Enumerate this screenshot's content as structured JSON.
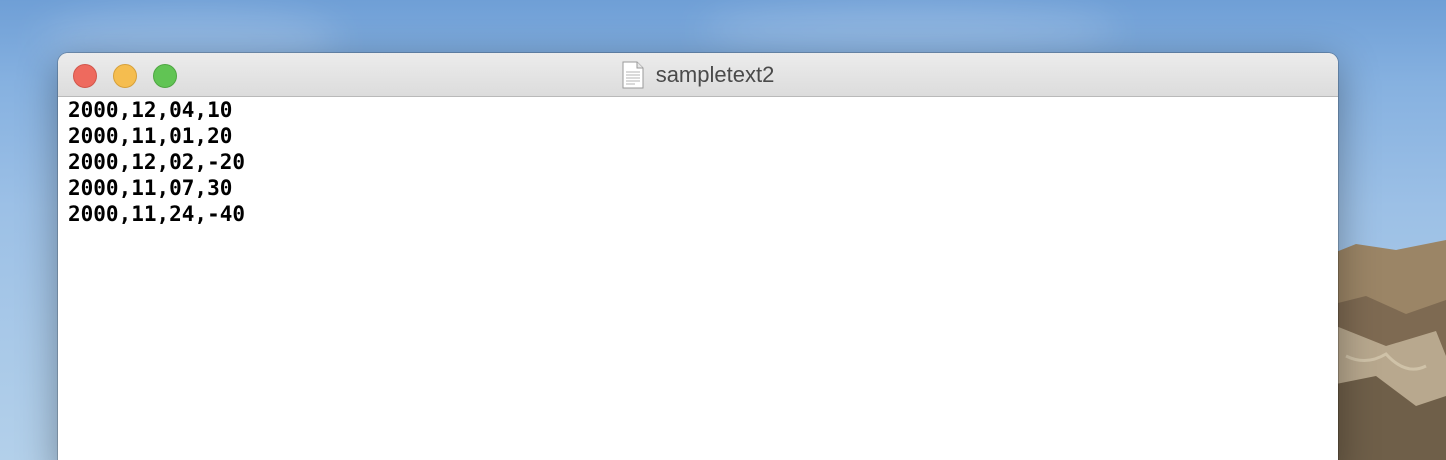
{
  "window": {
    "title": "sampletext2",
    "title_icon": "plain-text-document-icon"
  },
  "traffic_lights": {
    "close_color": "#ee6a5e",
    "minimize_color": "#f5bd4f",
    "zoom_color": "#61c454"
  },
  "document": {
    "lines": [
      "2000,12,04,10",
      "2000,11,01,20",
      "2000,12,02,-20",
      "2000,11,07,30",
      "2000,11,24,-40"
    ]
  }
}
